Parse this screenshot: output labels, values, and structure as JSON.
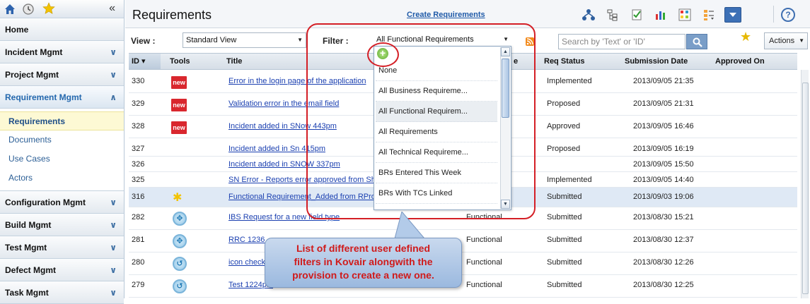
{
  "sidebar": {
    "sections": [
      {
        "label": "Home",
        "top": 0
      },
      {
        "label": "Incident Mgmt"
      },
      {
        "label": "Project Mgmt"
      },
      {
        "label": "Requirement Mgmt"
      },
      {
        "label": "Configuration Mgmt"
      },
      {
        "label": "Build Mgmt"
      },
      {
        "label": "Test Mgmt"
      },
      {
        "label": "Defect Mgmt"
      },
      {
        "label": "Task Mgmt"
      }
    ],
    "sub_items": [
      "Requirements",
      "Documents",
      "Use Cases",
      "Actors"
    ],
    "collapse_label": "«"
  },
  "header": {
    "title": "Requirements",
    "create_link": "Create Requirements",
    "help_label": "?"
  },
  "filterbar": {
    "view_label": "View :",
    "view_value": "Standard View",
    "filter_label": "Filter :",
    "filter_value": "All Functional Requirements",
    "search_placeholder": "Search by 'Text' or 'ID'",
    "actions_label": "Actions"
  },
  "table": {
    "headers": {
      "id": "ID",
      "tools": "Tools",
      "title": "Title",
      "type": "e",
      "status": "Req Status",
      "date": "Submission Date",
      "approved": "Approved On"
    },
    "rows": [
      {
        "id": "330",
        "title": "Error in the login page of the application",
        "type": "",
        "status": "Implemented",
        "date": "2013/09/05 21:35",
        "tool": "new"
      },
      {
        "id": "329",
        "title": "Validation error in the email field",
        "type": "",
        "status": "Proposed",
        "date": "2013/09/05 21:31",
        "tool": "new"
      },
      {
        "id": "328",
        "title": "Incident added in SNow 443pm",
        "type": "",
        "status": "Approved",
        "date": "2013/09/05 16:46",
        "tool": "new"
      },
      {
        "id": "327",
        "title": "Incident added in Sn 415pm",
        "type": "",
        "status": "Proposed",
        "date": "2013/09/05 16:19",
        "tool": ""
      },
      {
        "id": "326",
        "title": "Incident added in SNOW 337pm",
        "type": "",
        "status": "",
        "date": "2013/09/05 15:50",
        "tool": ""
      },
      {
        "id": "325",
        "title": "SN Error - Reports error approved from Sh",
        "type": "",
        "status": "Implemented",
        "date": "2013/09/05 14:40",
        "tool": ""
      },
      {
        "id": "316",
        "title": "Functional Requirement_Added from RPro f",
        "type": "",
        "status": "Submitted",
        "date": "2013/09/03 19:06",
        "tool": "fn"
      },
      {
        "id": "282",
        "title": "IBS Request for a new field type",
        "type": "Functional",
        "status": "Submitted",
        "date": "2013/08/30 15:21",
        "tool": "arrows"
      },
      {
        "id": "281",
        "title": "RRC 1236",
        "type": "Functional",
        "status": "Submitted",
        "date": "2013/08/30 12:37",
        "tool": "arrows"
      },
      {
        "id": "280",
        "title": "icon check",
        "type": "Functional",
        "status": "Submitted",
        "date": "2013/08/30 12:26",
        "tool": "cycle"
      },
      {
        "id": "279",
        "title": "Test 1224pm",
        "type": "Functional",
        "status": "Submitted",
        "date": "2013/08/30 12:25",
        "tool": "cycle"
      }
    ]
  },
  "dropdown": {
    "items": [
      "None",
      "All Business Requireme...",
      "All Functional Requirem...",
      "All Requirements",
      "All Technical Requireme...",
      "BRs Entered This Week",
      "BRs With TCs Linked"
    ],
    "selected_index": 2
  },
  "callout": {
    "lines": [
      "List of different user defined",
      "filters in Kovair alongwith the",
      "provision to create a new one."
    ]
  },
  "colors": {
    "accent": "#2468ae",
    "annotation_red": "#d41f26",
    "callout_bg": "#a9c3e5"
  }
}
